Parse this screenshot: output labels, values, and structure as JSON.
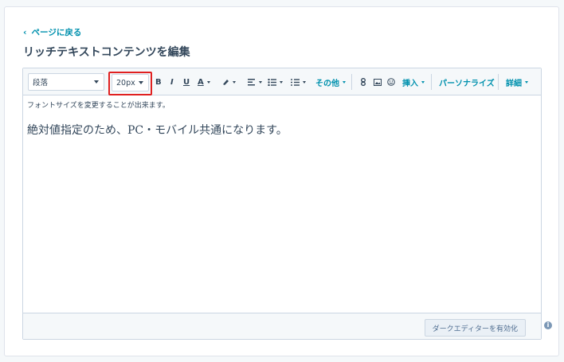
{
  "back_link": "ページに戻る",
  "page_title": "リッチテキストコンテンツを編集",
  "toolbar": {
    "paragraph_select": "段落",
    "font_size_select": "20px",
    "bold": "B",
    "italic": "I",
    "underline": "U",
    "text_color": "A",
    "more": "その他",
    "insert": "挿入",
    "personalize": "パーソナライズ",
    "advanced": "詳細"
  },
  "content": {
    "hint": "フォントサイズを変更することが出来ます。",
    "main_text": "絶対値指定のため、PC・モバイル共通になります。"
  },
  "footer": {
    "dark_editor_button": "ダークエディターを有効化",
    "info": "i"
  }
}
